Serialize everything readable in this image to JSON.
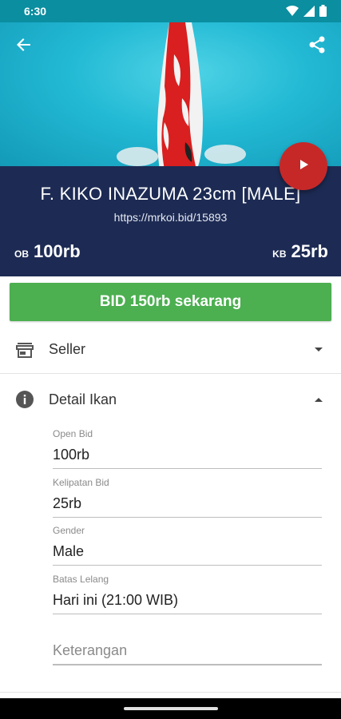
{
  "status_bar": {
    "time": "6:30"
  },
  "hero": {
    "back_icon": "arrow-left-icon",
    "share_icon": "share-icon"
  },
  "listing": {
    "title": "F. KIKO INAZUMA 23cm [MALE]",
    "url": "https://mrkoi.bid/15893",
    "ob_label": "OB",
    "ob_value": "100rb",
    "kb_label": "KB",
    "kb_value": "25rb"
  },
  "play_button": {
    "icon": "play-icon",
    "color": "#c62828"
  },
  "bid_button": {
    "label": "BID 150rb sekarang",
    "color": "#4caf50"
  },
  "sections": {
    "seller": {
      "label": "Seller",
      "icon": "store-icon",
      "expanded": false
    },
    "detail": {
      "label": "Detail Ikan",
      "icon": "info-icon",
      "expanded": true
    }
  },
  "detail_fields": [
    {
      "label": "Open Bid",
      "value": "100rb"
    },
    {
      "label": "Kelipatan Bid",
      "value": "25rb"
    },
    {
      "label": "Gender",
      "value": "Male"
    },
    {
      "label": "Batas Lelang",
      "value": "Hari ini (21:00 WIB)"
    }
  ],
  "notes_field": {
    "placeholder": "Keterangan"
  },
  "colors": {
    "status_bar": "#0a8ea0",
    "info_panel": "#1d2b54"
  }
}
